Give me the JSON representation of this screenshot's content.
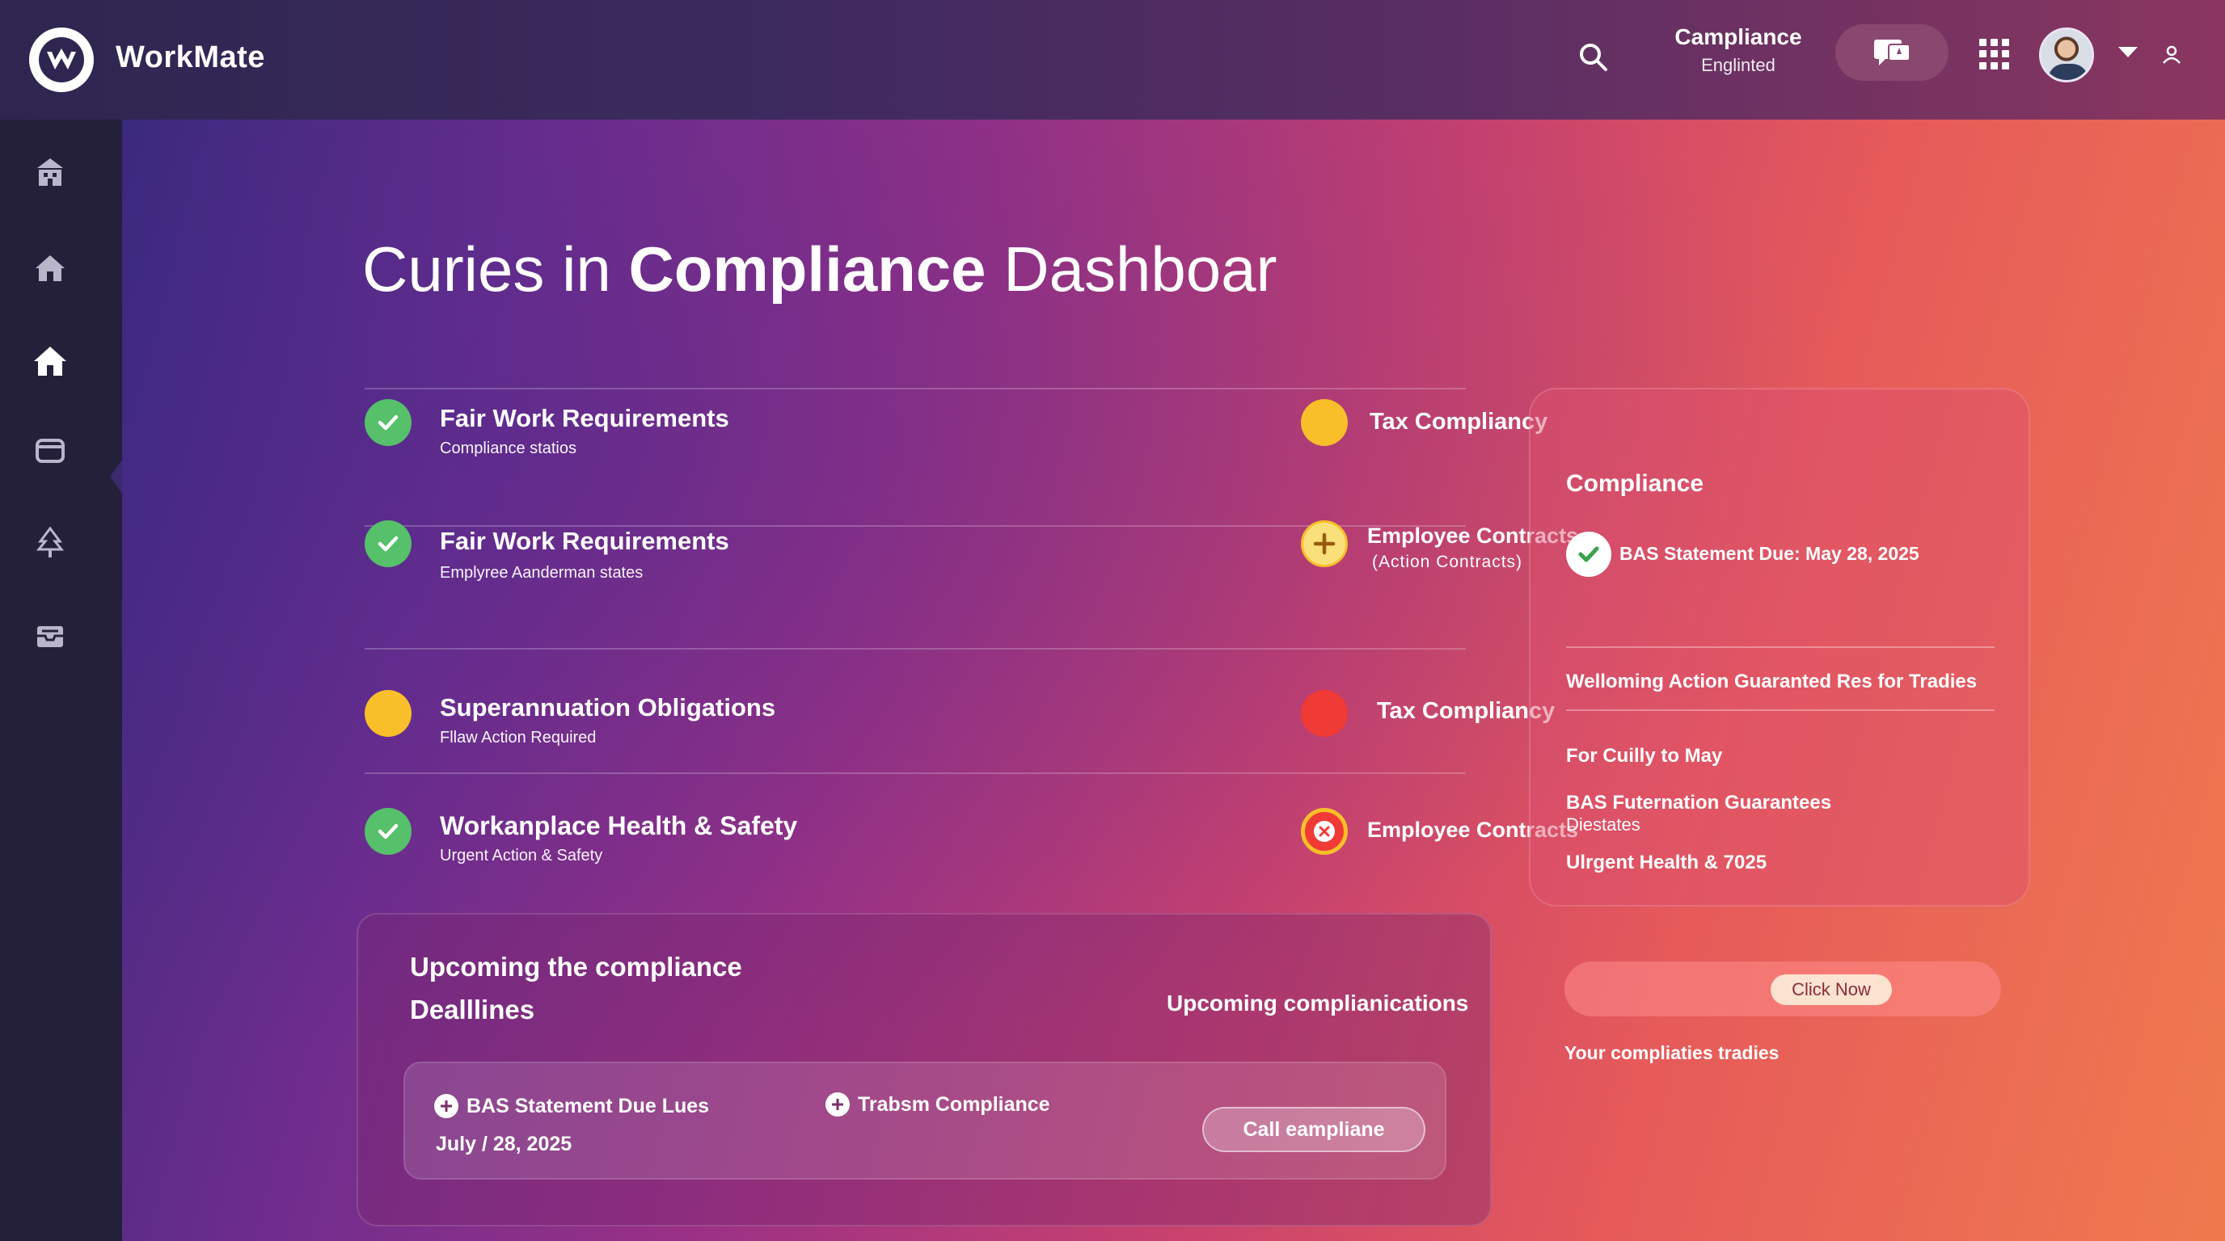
{
  "app": {
    "brand": "WorkMate"
  },
  "header": {
    "compliance_title": "Campliance",
    "compliance_sub": "Englinted"
  },
  "page": {
    "title_light": "Curies in",
    "title_bold": "Compliance",
    "title_end": "Dashboar"
  },
  "rows": [
    {
      "title": "Fair Work Requirements",
      "sub": "Compliance statios",
      "status": "complete",
      "right_label": "Tax Compliancy",
      "right_status": "warning",
      "right_sub": ""
    },
    {
      "title": "Fair Work Requirements",
      "sub": "Emplyree Aanderman states",
      "status": "complete",
      "right_label": "Employee Contracts",
      "right_status": "add",
      "right_sub": "(Action Contracts)"
    },
    {
      "title": "Superannuation Obligations",
      "sub": "Fllaw Action Required",
      "status": "warning",
      "right_label": "Tax Compliancy",
      "right_status": "error",
      "right_sub": ""
    },
    {
      "title": "Workanplace Health & Safety",
      "sub": "Urgent Action & Safety",
      "status": "complete",
      "right_label": "Employee Contracts",
      "right_status": "failed",
      "right_sub": ""
    }
  ],
  "deadlines": {
    "title_line1": "Upcoming the compliance",
    "title_line2": "Dealllines",
    "right_label": "Upcoming complianications",
    "item1": "BAS Statement Due Lues",
    "item1_date": "July / 28, 2025",
    "item2": "Trabsm Compliance",
    "button": "Call eampliane"
  },
  "card": {
    "title": "Compliance",
    "due": "BAS Statement Due: May 28, 2025",
    "line1": "Welloming Action Guaranted Res for Tradies",
    "line2": "For Cuilly to May",
    "line3": "BAS Futernation Guarantees",
    "line3_sub": "Diestates",
    "line4": "Ulrgent Health & 7025"
  },
  "cta": {
    "button": "Click Now",
    "footer": "Your compliaties tradies"
  },
  "colors": {
    "complete": "#56c06a",
    "warning": "#f8bf2a",
    "error": "#f03a36",
    "sidebar": "#25203a"
  },
  "icons": {
    "sidebar": [
      "building-icon",
      "home-icon",
      "home-filled-icon",
      "box-icon",
      "tree-icon",
      "inbox-icon"
    ]
  }
}
